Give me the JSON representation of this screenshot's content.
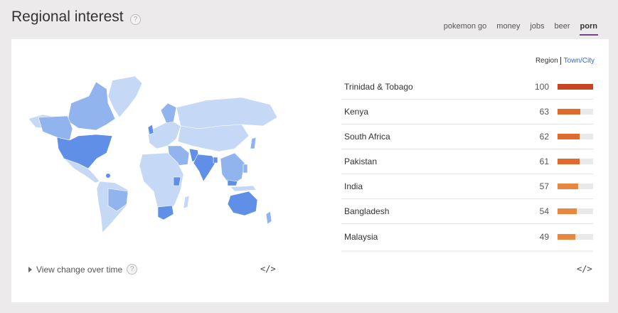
{
  "header": {
    "title": "Regional interest",
    "help": "?"
  },
  "terms": [
    {
      "label": "pokemon go",
      "active": false
    },
    {
      "label": "money",
      "active": false
    },
    {
      "label": "jobs",
      "active": false
    },
    {
      "label": "beer",
      "active": false
    },
    {
      "label": "porn",
      "active": true
    }
  ],
  "toggle": {
    "region": "Region",
    "town": "Town/City"
  },
  "footer": {
    "view_change": "View change over time",
    "help": "?",
    "embed": "</>"
  },
  "colors": {
    "bar_high": "#c9451f",
    "bar_mid": "#e06a2b",
    "bar_low": "#e8873f",
    "map_base": "#c5d9f6",
    "map_mid": "#92b4ee",
    "map_high": "#5f8fe6"
  },
  "map_icon": "world-map",
  "regions": [
    {
      "name": "Trinidad & Tobago",
      "value": 100
    },
    {
      "name": "Kenya",
      "value": 63
    },
    {
      "name": "South Africa",
      "value": 62
    },
    {
      "name": "Pakistan",
      "value": 61
    },
    {
      "name": "India",
      "value": 57
    },
    {
      "name": "Bangladesh",
      "value": 54
    },
    {
      "name": "Malaysia",
      "value": 49
    }
  ]
}
